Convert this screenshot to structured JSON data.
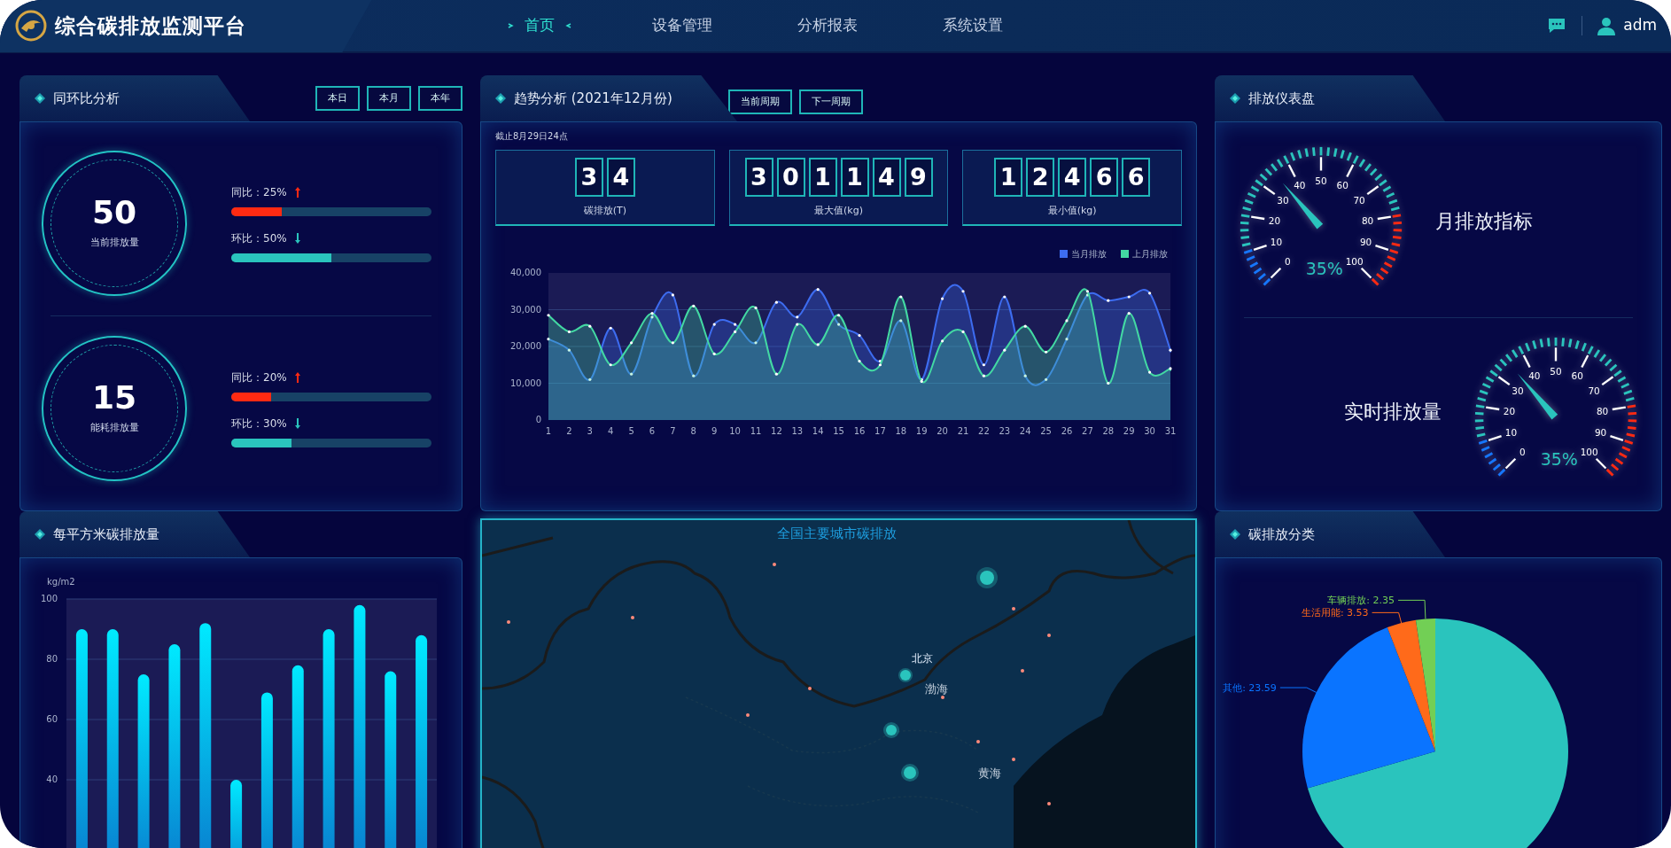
{
  "header": {
    "title": "综合碳排放监测平台",
    "nav": [
      {
        "label": "首页",
        "selected": true
      },
      {
        "label": "设备管理",
        "selected": false
      },
      {
        "label": "分析报表",
        "selected": false
      },
      {
        "label": "系统设置",
        "selected": false
      }
    ],
    "user": "adm"
  },
  "yoy_panel": {
    "title": "同环比分析",
    "buttons": [
      "本日",
      "本月",
      "本年"
    ],
    "groups": [
      {
        "value": "50",
        "caption": "当前排放量",
        "stats": [
          {
            "kind": "up",
            "label": "同比：25%",
            "level": 0.25
          },
          {
            "kind": "down",
            "label": "环比：50%",
            "level": 0.5
          }
        ]
      },
      {
        "value": "15",
        "caption": "能耗排放量",
        "stats": [
          {
            "kind": "up",
            "label": "同比：20%",
            "level": 0.2
          },
          {
            "kind": "down",
            "label": "环比：30%",
            "level": 0.3
          }
        ]
      }
    ]
  },
  "trend_panel": {
    "title": "趋势分析 (2021年12月份)",
    "buttons": [
      "当前周期",
      "下一周期"
    ],
    "note": "截止8月29日24点",
    "counters": [
      {
        "digits": [
          "3",
          "4"
        ],
        "caption": "碳排放(T)"
      },
      {
        "digits": [
          "3",
          "0",
          "1",
          "1",
          "4",
          "9"
        ],
        "caption": "最大值(kg)"
      },
      {
        "digits": [
          "1",
          "2",
          "4",
          "6",
          "6"
        ],
        "caption": "最小值(kg)"
      }
    ],
    "chart_data": {
      "type": "area",
      "grid": true,
      "stacked": false,
      "x": [
        1,
        2,
        3,
        4,
        5,
        6,
        7,
        8,
        9,
        10,
        11,
        12,
        13,
        14,
        15,
        16,
        17,
        18,
        19,
        20,
        21,
        22,
        23,
        24,
        25,
        26,
        27,
        28,
        29,
        30,
        31
      ],
      "ylim": [
        0,
        40000
      ],
      "yticks": [
        {
          "value": 0,
          "label": "0"
        },
        {
          "value": 10000,
          "label": "10,000"
        },
        {
          "value": 20000,
          "label": "20,000"
        },
        {
          "value": 30000,
          "label": "30,000"
        },
        {
          "value": 40000,
          "label": "40,000"
        }
      ],
      "series": [
        {
          "name": "当月排放",
          "color": "#3d6cf0",
          "values": [
            22000,
            19000,
            11000,
            25000,
            12500,
            28000,
            34000,
            12000,
            26000,
            26000,
            21000,
            32000,
            28000,
            35500,
            26000,
            23000,
            16000,
            27000,
            11000,
            33000,
            35000,
            15000,
            33500,
            12000,
            11000,
            22000,
            34000,
            32500,
            33500,
            34500,
            19000
          ]
        },
        {
          "name": "上月排放",
          "color": "#43d9a3",
          "values": [
            28500,
            24000,
            25500,
            15000,
            21000,
            29000,
            21000,
            31000,
            18000,
            24000,
            30500,
            12500,
            26000,
            20500,
            28500,
            16000,
            15000,
            33500,
            10500,
            21500,
            24000,
            12000,
            19000,
            25500,
            18500,
            27000,
            35000,
            10000,
            29000,
            13000,
            14000
          ]
        }
      ]
    }
  },
  "gauge_panel": {
    "title": "排放仪表盘",
    "gauges": [
      {
        "label": "月排放指标",
        "reading": "35%",
        "level": 0.35,
        "ticks": [
          "0",
          "10",
          "20",
          "30",
          "40",
          "50",
          "60",
          "70",
          "80",
          "90",
          "100"
        ]
      },
      {
        "label": "实时排放量",
        "reading": "35%",
        "level": 0.35,
        "ticks": [
          "0",
          "10",
          "20",
          "30",
          "40",
          "50",
          "60",
          "70",
          "80",
          "90",
          "100"
        ]
      }
    ]
  },
  "bar_panel": {
    "title": "每平方米碳排放量",
    "chart_data": {
      "type": "bar",
      "grid": true,
      "ylabel": "kg/m2",
      "values": [
        90,
        90,
        75,
        85,
        92,
        40,
        69,
        78,
        90,
        98,
        76,
        88
      ],
      "ylim": [
        0,
        100
      ],
      "yticks": [
        40,
        60,
        80,
        100
      ]
    }
  },
  "map_panel": {
    "title": "全国主要城市碳排放",
    "labels": [
      {
        "kind": "city",
        "text": "北京"
      },
      {
        "kind": "sea",
        "text": "渤海"
      },
      {
        "kind": "sea",
        "text": "黄海"
      }
    ]
  },
  "pie_panel": {
    "title": "碳排放分类",
    "chart_data": {
      "type": "pie",
      "values": [
        70.53,
        23.59,
        3.53,
        2.35
      ],
      "colors": [
        "#2ac4bd",
        "#0a74ff",
        "#ff6a1a",
        "#72cf55"
      ],
      "value_labels": [
        null,
        "其他: 23.59",
        "生活用能: 3.53",
        "车辆排放: 2.35"
      ]
    }
  }
}
